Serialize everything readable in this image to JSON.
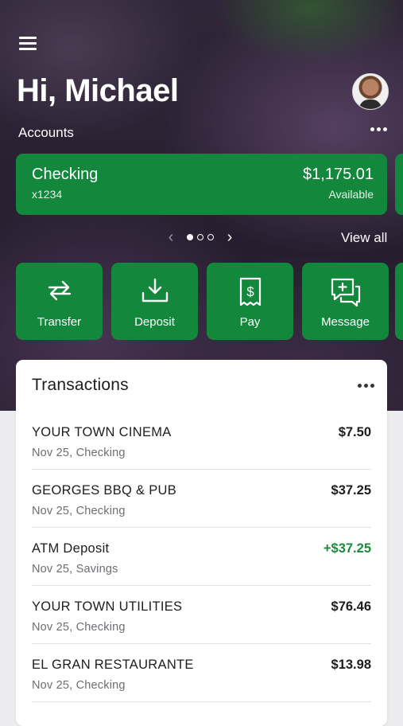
{
  "greeting": "Hi, Michael",
  "accounts": {
    "label": "Accounts",
    "card": {
      "name": "Checking",
      "number": "x1234",
      "balance": "$1,175.01",
      "balance_label": "Available"
    },
    "pager": {
      "pages": 3,
      "current": 1
    },
    "view_all": "View all"
  },
  "actions": [
    {
      "label": "Transfer",
      "icon": "transfer-icon"
    },
    {
      "label": "Deposit",
      "icon": "deposit-icon"
    },
    {
      "label": "Pay",
      "icon": "pay-icon"
    },
    {
      "label": "Message",
      "icon": "message-icon"
    }
  ],
  "transactions": {
    "title": "Transactions",
    "items": [
      {
        "merchant": "YOUR TOWN CINEMA",
        "detail": "Nov 25, Checking",
        "amount": "$7.50"
      },
      {
        "merchant": "GEORGES BBQ & PUB",
        "detail": "Nov 25, Checking",
        "amount": "$37.25"
      },
      {
        "merchant": "ATM Deposit",
        "detail": "Nov 25, Savings",
        "amount": "+$37.25"
      },
      {
        "merchant": "YOUR TOWN UTILITIES",
        "detail": "Nov 25, Checking",
        "amount": "$76.46"
      },
      {
        "merchant": "EL GRAN RESTAURANTE",
        "detail": "Nov 25, Checking",
        "amount": "$13.98"
      }
    ]
  },
  "colors": {
    "brand_green": "#13873b",
    "positive_amount": "#1a8a3e"
  }
}
